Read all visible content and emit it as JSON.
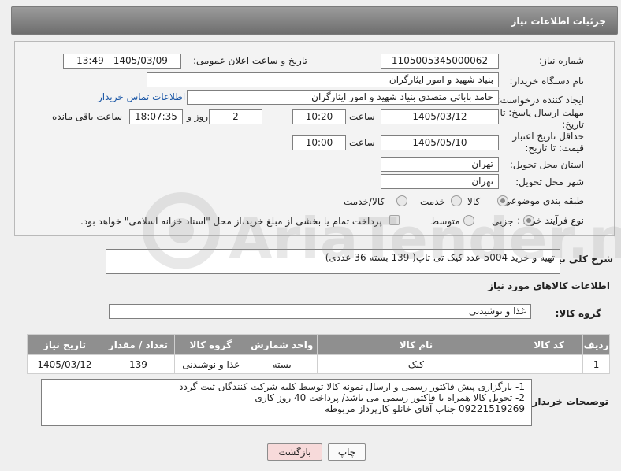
{
  "header": {
    "title": "جزئیات اطلاعات نیاز"
  },
  "fields": {
    "need_number_label": "شماره نیاز:",
    "need_number": "1105005345000062",
    "announce_label": "تاریخ و ساعت اعلان عمومی:",
    "announce_value": "1405/03/09 - 13:49",
    "buyer_org_label": "نام دستگاه خریدار:",
    "buyer_org": "بنیاد شهید و امور ایثارگران",
    "requester_label": "ایجاد کننده درخواست:",
    "requester": "حامد بابائی متصدی بنیاد شهید و امور ایثارگران",
    "buyer_contact_link": "اطلاعات تماس خریدار",
    "reply_deadline_label": "مهلت ارسال پاسخ: تا تاریخ:",
    "reply_date": "1405/03/12",
    "time_label": "ساعت",
    "reply_time": "10:20",
    "days_count": "2",
    "days_label": "روز و",
    "remaining_time": "18:07:35",
    "remaining_label": "ساعت باقی مانده",
    "price_valid_label": "حداقل تاریخ اعتبار قیمت: تا تاریخ:",
    "price_valid_date": "1405/05/10",
    "price_valid_time": "10:00",
    "delivery_province_label": "استان محل تحویل:",
    "delivery_province": "تهران",
    "delivery_city_label": "شهر محل تحویل:",
    "delivery_city": "تهران",
    "category_label": "طبقه بندی موضوعی:",
    "category_options": [
      "کالا",
      "خدمت",
      "کالا/خدمت"
    ],
    "process_label": "نوع فرآیند خرید :",
    "process_options": [
      "جزیی",
      "متوسط"
    ],
    "payment_note": "پرداخت تمام یا بخشی از مبلغ خرید،از محل \"اسناد خزانه اسلامی\" خواهد بود."
  },
  "description": {
    "label": "شرح کلی نیاز:",
    "value": "تهیه و خرید 5004 عدد کیک تی تاپ( 139 بسته 36 عددی)"
  },
  "goods": {
    "section_title": "اطلاعات کالاهای مورد نیاز",
    "group_label": "گروه کالا:",
    "group_value": "غذا و نوشیدنی",
    "columns": [
      "ردیف",
      "کد کالا",
      "نام کالا",
      "واحد شمارش",
      "گروه کالا",
      "تعداد / مقدار",
      "تاریخ نیاز"
    ],
    "rows": [
      [
        "1",
        "--",
        "کیک",
        "بسته",
        "غذا و نوشیدنی",
        "139",
        "1405/03/12"
      ]
    ]
  },
  "buyer_notes": {
    "label": "توضیحات خریدار:",
    "lines": [
      "1- بارگزاری پیش فاکتور رسمی و ارسال نمونه کالا توسط کلیه شرکت کنندگان ثبت گردد",
      "2- تحویل کالا همراه با فاکتور رسمی می باشد/ پرداخت 40 روز کاری",
      "09221519269 جناب آقای خانلو کارپرداز مربوطه"
    ]
  },
  "buttons": {
    "print": "چاپ",
    "back": "بازگشت"
  },
  "watermark": {
    "brand": "AriaTender.net"
  },
  "colors": {
    "header_bg": "#808080",
    "link": "#1b57a6",
    "back_button_bg": "#f7dada"
  }
}
